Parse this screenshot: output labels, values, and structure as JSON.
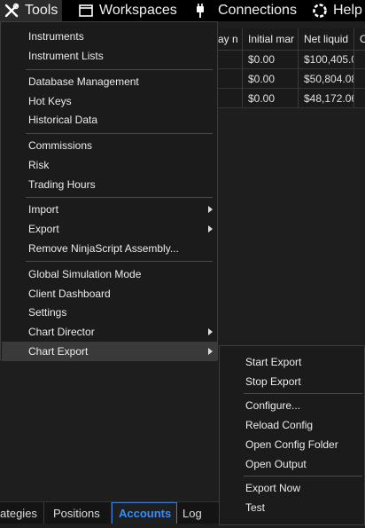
{
  "menubar": {
    "items": [
      {
        "label": "Tools",
        "icon": "tools-icon"
      },
      {
        "label": "Workspaces",
        "icon": "window-icon"
      },
      {
        "label": "Connections",
        "icon": "plug-icon"
      },
      {
        "label": "Help",
        "icon": "help-icon"
      }
    ]
  },
  "grid": {
    "headers": [
      "ay n",
      "Initial mar",
      "Net liquid",
      "C"
    ],
    "rows": [
      [
        "",
        "$0.00",
        "$100,405.0",
        ""
      ],
      [
        "",
        "$0.00",
        "$50,804.08",
        ""
      ],
      [
        "",
        "$0.00",
        "$48,172.06",
        ""
      ]
    ]
  },
  "tools_menu": {
    "groups": [
      [
        "Instruments",
        "Instrument Lists"
      ],
      [
        "Database Management",
        "Hot Keys",
        "Historical Data"
      ],
      [
        "Commissions",
        "Risk",
        "Trading Hours"
      ],
      [
        "Import",
        "Export",
        "Remove NinjaScript Assembly..."
      ],
      [
        "Global Simulation Mode",
        "Client Dashboard",
        "Settings",
        "Chart Director",
        "Chart Export"
      ]
    ]
  },
  "chart_export_submenu": {
    "groups": [
      [
        "Start Export",
        "Stop Export"
      ],
      [
        "Configure...",
        "Reload Config",
        "Open Config Folder",
        "Open Output"
      ],
      [
        "Export Now",
        "Test"
      ]
    ]
  },
  "tabs": [
    "ategies",
    "Positions",
    "Accounts",
    "Log"
  ],
  "colors": {
    "accent": "#2f8fff",
    "background": "#1e1e1e"
  }
}
